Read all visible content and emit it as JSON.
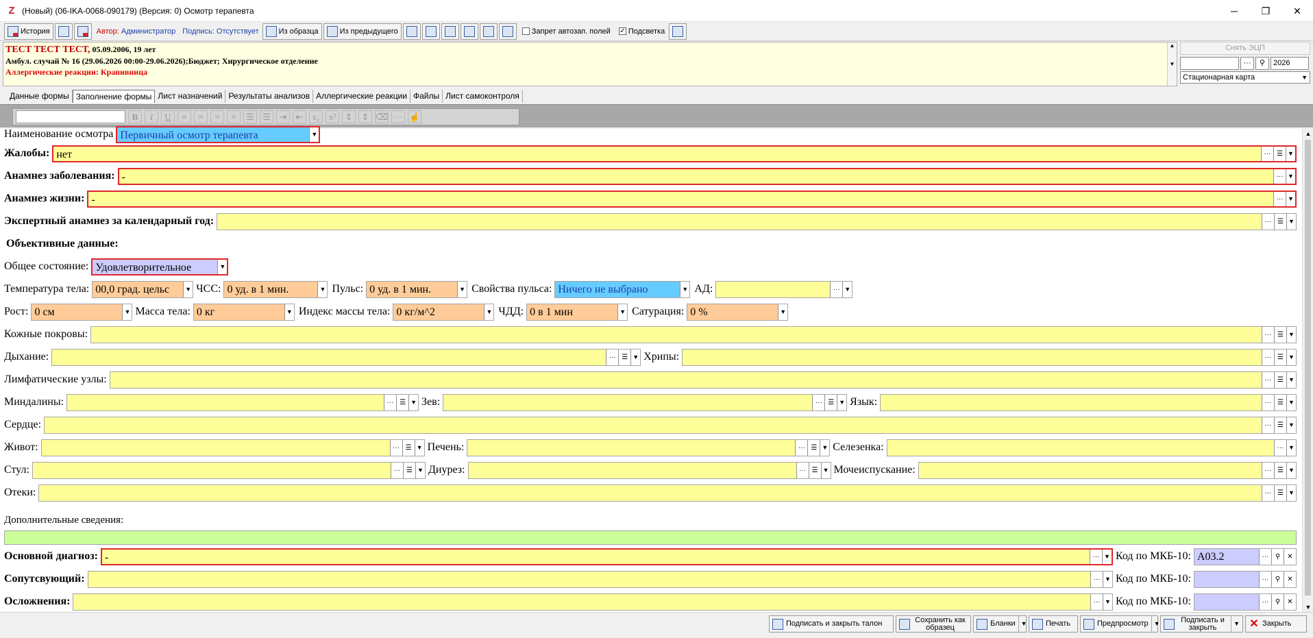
{
  "window": {
    "title": "(Новый) (06-IKA-0068-090179) (Версия: 0) Осмотр терапевта",
    "minimize": "─",
    "maximize": "❐",
    "close": "✕"
  },
  "toolbar": {
    "history": "История",
    "author_label": "Автор:",
    "author": "Администратор",
    "sign_label": "Подпись:",
    "sign_value": "Отсутствует",
    "from_template": "Из образца",
    "from_previous": "Из предыдущего",
    "autofill_ban": "Запрет автозап. полей",
    "highlight": "Подсветка",
    "check": "✓"
  },
  "header": {
    "patient": "ТЕСТ ТЕСТ ТЕСТ,",
    "dob": " 05.09.2006, 19 лет",
    "case": "Амбул. случай  № 16 (29.06.2026 00:00-29.06.2026);Бюджет; Хирургическое отделение",
    "allergy": "Аллергические реакции: Крапивница"
  },
  "side": {
    "remove_sign": "Снять ЭЦП",
    "year": "2026",
    "card_type": "Стационарная карта"
  },
  "tabs": [
    "Данные формы",
    "Заполнение формы",
    "Лист назначений",
    "Результаты анализов",
    "Аллергические реакции",
    "Файлы",
    "Лист самоконтроля"
  ],
  "form": {
    "exam_name_label": "Наименование осмотра",
    "exam_name": "Первичный осмотр терапевта",
    "complaints_label": "Жалобы:",
    "complaints": "нет",
    "disease_history_label": "Анамнез заболевания:",
    "disease_history": "-",
    "life_history_label": "Анамнез жизни:",
    "life_history": "-",
    "expert_history_label": "Экспертный анамнез за календарный год:",
    "objective_label": "Объективные данные:",
    "general_state_label": "Общее состояние:",
    "general_state": "Удовлетворительное",
    "temp_label": "Температура тела:",
    "temp": "00,0 град. цельс",
    "hr_label": "ЧСС:",
    "hr": "0 уд. в 1 мин.",
    "pulse_label": "Пульс:",
    "pulse": "0 уд. в 1 мин.",
    "pulse_props_label": "Свойства пульса:",
    "pulse_props": "Ничего не выбрано",
    "bp_label": "АД:",
    "height_label": "Рост:",
    "height": "0 см",
    "weight_label": "Масса тела:",
    "weight": "0 кг",
    "bmi_label": "Индекс массы тела:",
    "bmi": "0 кг/м^2",
    "rr_label": "ЧДД:",
    "rr": "0 в 1 мин",
    "sat_label": "Сатурация:",
    "sat": "0 %",
    "skin_label": "Кожные покровы:",
    "breathing_label": "Дыхание:",
    "rales_label": "Хрипы:",
    "lymph_label": "Лимфатические узлы:",
    "tonsils_label": "Миндалины:",
    "pharynx_label": "Зев:",
    "tongue_label": "Язык:",
    "heart_label": "Сердце:",
    "abdomen_label": "Живот:",
    "liver_label": "Печень:",
    "spleen_label": "Селезенка:",
    "stool_label": "Стул:",
    "diuresis_label": "Диурез:",
    "urination_label": "Мочеиспускание:",
    "edema_label": "Отеки:",
    "additional_label": "Дополнительные сведения:",
    "main_diag_label": "Основной диагноз:",
    "main_diag": "-",
    "icd_label": "Код по МКБ-10:",
    "icd_main": "A03.2",
    "concomitant_label": "Сопутсвующий:",
    "complications_label": "Осложнения:"
  },
  "bottom": {
    "sign_close": "Подписать и закрыть талон",
    "save_template": "Сохранить как образец",
    "blanks": "Бланки",
    "print": "Печать",
    "preview": "Предпросмотр",
    "sign_and_close": "Подписать и закрыть",
    "close": "Закрыть"
  },
  "colors": {
    "field": "#ffff99",
    "required_border": "#e0262a",
    "numeric": "#ffcc99",
    "select_blue": "#66ccff",
    "select_violet": "#ccccff",
    "additional": "#ccff99"
  }
}
